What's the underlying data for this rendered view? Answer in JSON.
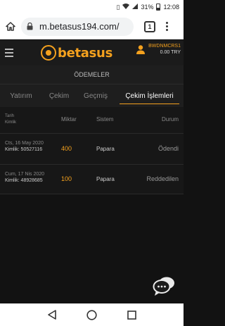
{
  "status_bar": {
    "battery": "31%",
    "time": "12:08"
  },
  "browser": {
    "url": "m.betasus194.com/",
    "tab_count": "1"
  },
  "site": {
    "brand": "betasus",
    "username": "BWDNMCRS1",
    "balance": "0.00 TRY",
    "accent": "#f4a11e"
  },
  "page_title": "ÖDEMELER",
  "tabs": [
    {
      "label": "Yatırım"
    },
    {
      "label": "Çekim"
    },
    {
      "label": "Geçmiş"
    },
    {
      "label": "Çekim İşlemleri",
      "active": true
    }
  ],
  "table": {
    "headers": {
      "date": "Tarih",
      "id": "Kimlik",
      "amount": "Miktar",
      "system": "Sistem",
      "status": "Durum"
    },
    "rows": [
      {
        "date": "Cts, 16 May 2020",
        "kimlik": "Kimlik: 50527116",
        "amount": "400",
        "system": "Papara",
        "status": "Ödendi"
      },
      {
        "date": "Cum, 17 Nis 2020",
        "kimlik": "Kimlik: 48928685",
        "amount": "100",
        "system": "Papara",
        "status": "Reddedilen"
      }
    ]
  }
}
